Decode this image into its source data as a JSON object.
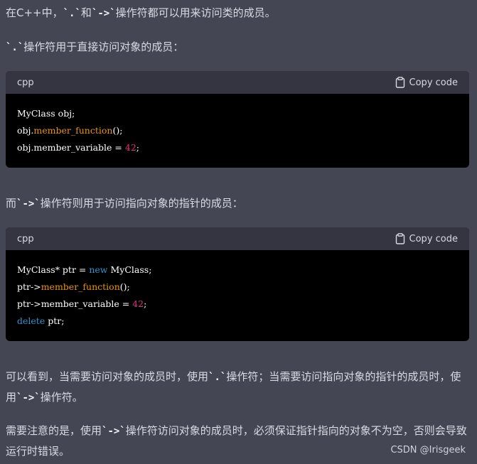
{
  "paragraphs": {
    "p1": {
      "pre": "在C++中，",
      "code1": "`.`",
      "mid": "和",
      "code2": "`->`",
      "post": "操作符都可以用来访问类的成员。"
    },
    "p2": {
      "code": "`.`",
      "post": "操作符用于直接访问对象的成员："
    },
    "p3": {
      "pre": "而",
      "code": "`->`",
      "post": "操作符则用于访问指向对象的指针的成员："
    },
    "p4": {
      "pre": "可以看到，当需要访问对象的成员时，使用",
      "code1": "`.`",
      "mid": "操作符；当需要访问指向对象的指针的成员时，使用",
      "code2": "`->`",
      "post": "操作符。"
    },
    "p5": {
      "pre": "需要注意的是，使用",
      "code": "`->`",
      "post": "操作符访问对象的成员时，必须保证指针指向的对象不为空，否则会导致运行时错误。"
    }
  },
  "code_blocks": [
    {
      "language": "cpp",
      "copy_label": "Copy code",
      "lines": [
        {
          "a": "MyClass obj;"
        },
        {
          "a": "obj.",
          "fn": "member_function",
          "b": "();"
        },
        {
          "a": "obj.member_variable = ",
          "num": "42",
          "b": ";"
        }
      ]
    },
    {
      "language": "cpp",
      "copy_label": "Copy code",
      "lines": [
        {
          "a": "MyClass* ptr = ",
          "kw": "new",
          "b": " MyClass;"
        },
        {
          "a": "ptr->",
          "fn": "member_function",
          "b": "();"
        },
        {
          "a": "ptr->member_variable = ",
          "num": "42",
          "b": ";"
        },
        {
          "kw": "delete",
          "b": " ptr;"
        }
      ]
    }
  ],
  "watermark": "CSDN @Irisgeek",
  "icons": {
    "copy": "clipboard-icon"
  },
  "colors": {
    "background": "#444654",
    "code_header": "#343541",
    "code_body": "#000000",
    "function": "#e9950c",
    "number": "#df3079",
    "keyword": "#2e95d3"
  }
}
